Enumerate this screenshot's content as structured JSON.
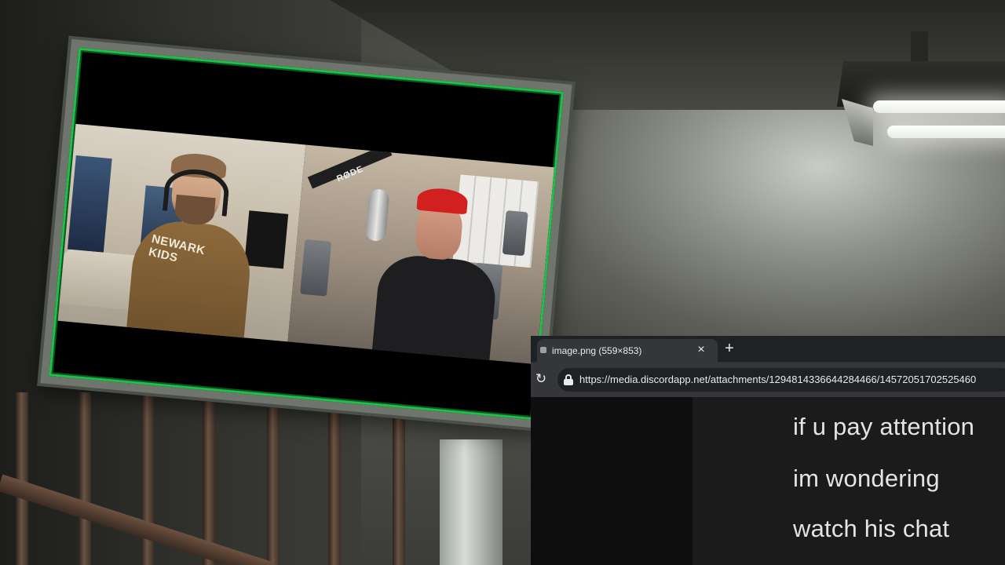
{
  "stream_cams": {
    "left_hoodie_text": "NEWARK KIDS",
    "right_mic_brand": "RØDE"
  },
  "browser": {
    "tab_title": "image.png (559×853)",
    "tab_close": "×",
    "new_tab": "+",
    "reload": "↻",
    "url": "https://media.discordapp.net/attachments/1294814336644284466/14572051702525460"
  },
  "image_content": {
    "messages": [
      "if u pay attention",
      "im wondering",
      "watch his chat"
    ]
  },
  "colors": {
    "monitor_glow": "#1fbf4a",
    "browser_bg": "#202124",
    "toolbar_bg": "#35363a",
    "chat_text": "#e4e4e4"
  }
}
